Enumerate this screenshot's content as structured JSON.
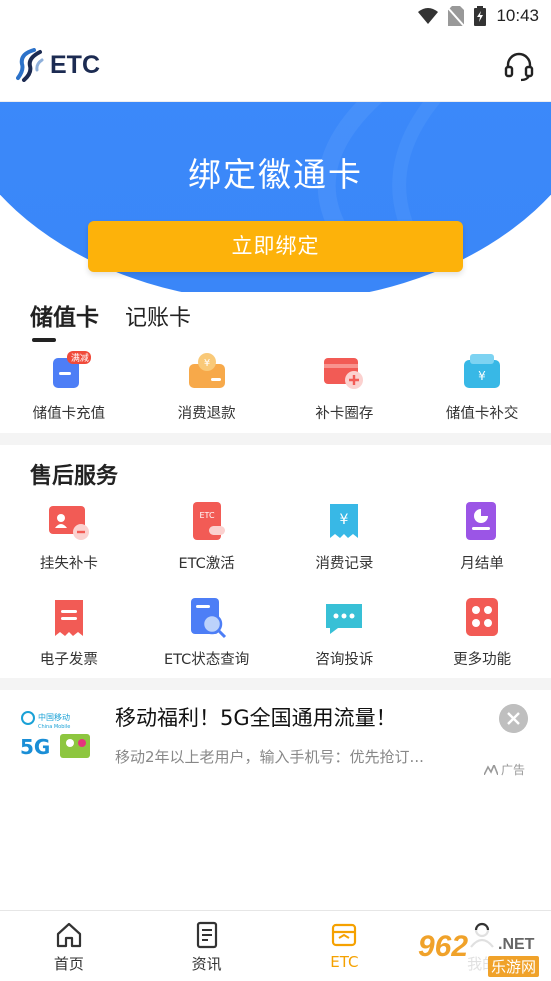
{
  "status_bar": {
    "time": "10:43"
  },
  "header": {
    "logo_text": "ETC"
  },
  "banner": {
    "title": "绑定徽通卡",
    "button_label": "立即绑定"
  },
  "card_tabs": [
    {
      "label": "储值卡",
      "active": true
    },
    {
      "label": "记账卡",
      "active": false
    }
  ],
  "stored_value_items": [
    {
      "label": "储值卡充值",
      "icon": "card-recharge-icon",
      "badge": "满减"
    },
    {
      "label": "消费退款",
      "icon": "refund-icon"
    },
    {
      "label": "补卡圈存",
      "icon": "card-load-icon"
    },
    {
      "label": "储值卡补交",
      "icon": "card-supplement-icon"
    }
  ],
  "after_sales": {
    "title": "售后服务",
    "items": [
      {
        "label": "挂失补卡",
        "icon": "report-loss-icon"
      },
      {
        "label": "ETC激活",
        "icon": "etc-activate-icon",
        "icon_text": "ETC"
      },
      {
        "label": "消费记录",
        "icon": "consumption-record-icon"
      },
      {
        "label": "月结单",
        "icon": "monthly-statement-icon"
      },
      {
        "label": "电子发票",
        "icon": "e-invoice-icon"
      },
      {
        "label": "ETC状态查询",
        "icon": "etc-status-query-icon"
      },
      {
        "label": "咨询投诉",
        "icon": "consult-complaint-icon"
      },
      {
        "label": "更多功能",
        "icon": "more-functions-icon"
      }
    ]
  },
  "ad": {
    "logo_cn": "中国移动",
    "logo_en": "China Mobile",
    "title": "移动福利！5G全国通用流量！",
    "description": "移动2年以上老用户，输入手机号：优先抢订...",
    "tag": "广告"
  },
  "bottom_nav": [
    {
      "label": "首页",
      "icon": "home-icon",
      "active": false
    },
    {
      "label": "资讯",
      "icon": "news-icon",
      "active": false
    },
    {
      "label": "ETC",
      "icon": "etc-card-icon",
      "active": true
    },
    {
      "label": "我的",
      "icon": "profile-icon",
      "active": false
    }
  ],
  "watermark": {
    "number": "962",
    "suffix": ".NET",
    "subtitle": "乐游网"
  },
  "colors": {
    "primary_blue": "#3a86f8",
    "accent_orange": "#fdb20a",
    "active_nav": "#f5a100"
  }
}
